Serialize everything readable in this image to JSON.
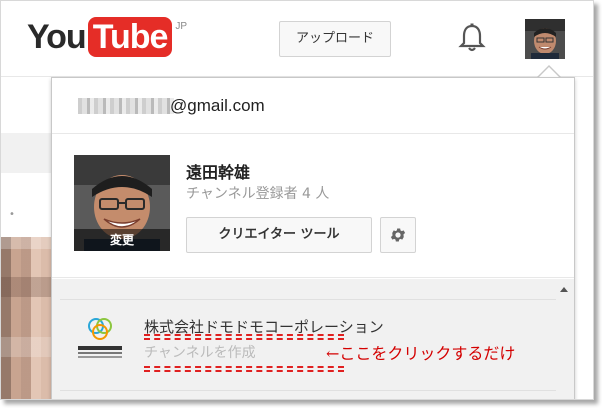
{
  "header": {
    "logo_you": "You",
    "logo_tube": "Tube",
    "logo_region": "JP",
    "upload_label": "アップロード"
  },
  "account": {
    "email_domain": "@gmail.com",
    "name": "遠田幹雄",
    "subscribers": "チャンネル登録者 4 人",
    "change_photo_label": "変更",
    "creator_tools_label": "クリエイター ツール"
  },
  "channels": {
    "items": [
      {
        "name": "株式会社ドモドモコーポレーション",
        "action": "チャンネルを作成"
      }
    ]
  },
  "annotation": {
    "text": "←ここをクリックするだけ"
  },
  "colors": {
    "brand_red": "#e52d27",
    "annotation_red": "#d40000"
  },
  "icons": [
    "bell-icon",
    "gear-icon",
    "caret-up-icon"
  ]
}
